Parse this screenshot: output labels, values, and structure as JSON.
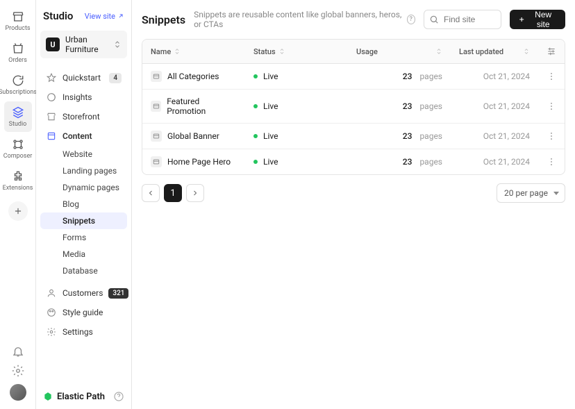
{
  "rail": {
    "items": [
      {
        "label": "Products"
      },
      {
        "label": "Orders"
      },
      {
        "label": "Subscriptions"
      },
      {
        "label": "Studio"
      },
      {
        "label": "Composer"
      },
      {
        "label": "Extensions"
      }
    ]
  },
  "sidebar": {
    "title": "Studio",
    "viewSite": "View site",
    "site": {
      "initial": "U",
      "name": "Urban Furniture"
    },
    "quickstart": {
      "label": "Quickstart",
      "badge": "4"
    },
    "insights": "Insights",
    "storefront": "Storefront",
    "content": {
      "label": "Content",
      "children": [
        "Website",
        "Landing pages",
        "Dynamic pages",
        "Blog",
        "Snippets",
        "Forms",
        "Media",
        "Database"
      ]
    },
    "customers": {
      "label": "Customers",
      "badge": "321"
    },
    "styleGuide": "Style guide",
    "settings": "Settings",
    "footerBrand": "Elastic Path"
  },
  "main": {
    "title": "Snippets",
    "subtitle": "Snippets are reusable content like global banners, heros, or CTAs",
    "searchPlaceholder": "Find site",
    "newButton": "New site",
    "columns": {
      "name": "Name",
      "status": "Status",
      "usage": "Usage",
      "updated": "Last updated"
    },
    "rows": [
      {
        "name": "All Categories",
        "status": "Live",
        "usageCount": "23",
        "usageLabel": "pages",
        "updated": "Oct 21, 2024"
      },
      {
        "name": "Featured Promotion",
        "status": "Live",
        "usageCount": "23",
        "usageLabel": "pages",
        "updated": "Oct 21, 2024"
      },
      {
        "name": "Global Banner",
        "status": "Live",
        "usageCount": "23",
        "usageLabel": "pages",
        "updated": "Oct 21, 2024"
      },
      {
        "name": "Home Page Hero",
        "status": "Live",
        "usageCount": "23",
        "usageLabel": "pages",
        "updated": "Oct 21, 2024"
      }
    ],
    "pagination": {
      "current": "1",
      "perPage": "20 per page"
    }
  }
}
